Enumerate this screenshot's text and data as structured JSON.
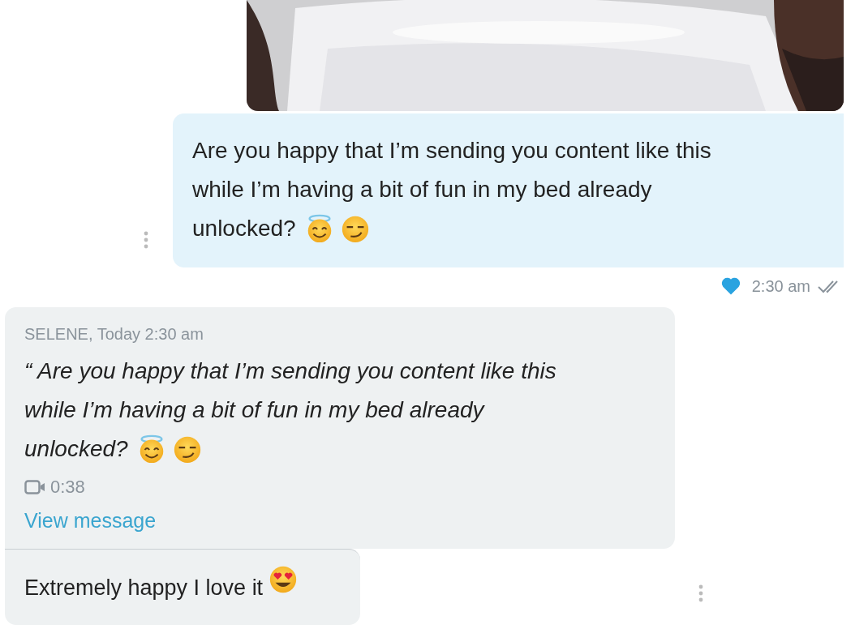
{
  "messages": [
    {
      "kind": "sent",
      "lines": [
        "Are you happy that I’m sending you content like this",
        "while I’m having a bit of fun in my bed already",
        "unlocked?"
      ],
      "time": "2:30 am",
      "liked": true,
      "read": true
    },
    {
      "kind": "received",
      "sender": "SELENE, Today 2:30 am",
      "quote_lines": [
        "“ Are you happy that I’m sending you content like this",
        "while I’m having a bit of fun in my bed already",
        "unlocked?"
      ],
      "duration": "0:38",
      "link": "View message",
      "reply": "Extremely happy I love it"
    }
  ]
}
